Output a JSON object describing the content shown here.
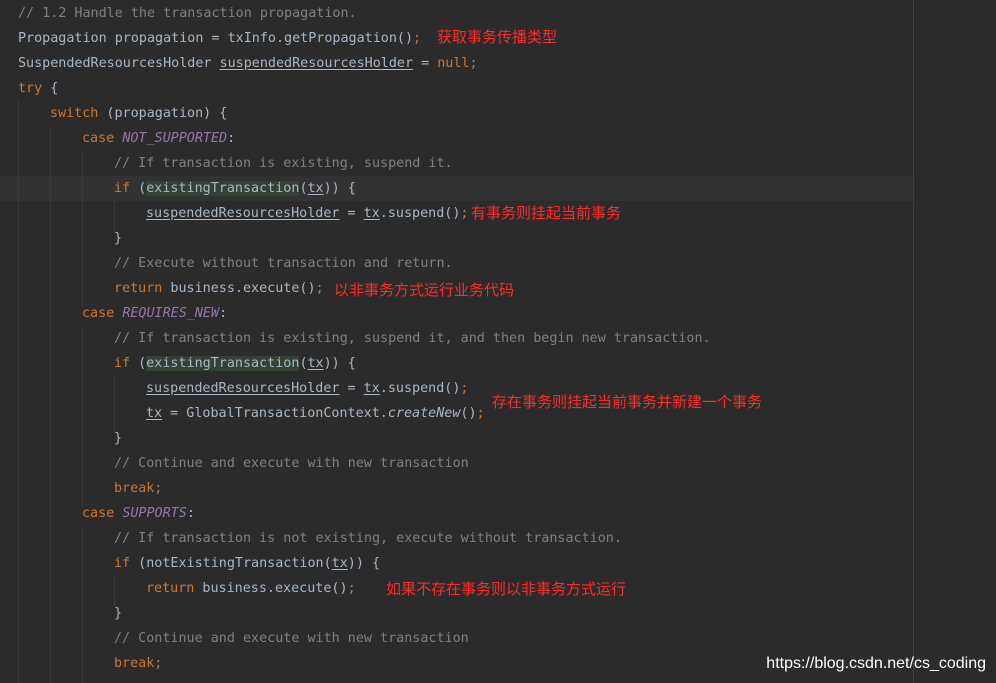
{
  "code": {
    "l1": {
      "comment": "// 1.2 Handle the transaction propagation."
    },
    "l2": {
      "t1": "Propagation propagation = txInfo.getPropagation()",
      "t2": ";"
    },
    "l3": {
      "t1": "SuspendedResourcesHolder ",
      "t2": "suspendedResourcesHolder",
      "t3": " = ",
      "t4": "null",
      "t5": ";"
    },
    "l4": {
      "kw": "try",
      "t1": " {"
    },
    "l5": {
      "kw": "switch",
      "t1": " (propagation) {"
    },
    "l6": {
      "kw": "case ",
      "const": "NOT_SUPPORTED",
      "t1": ":"
    },
    "l7": {
      "comment": "// If transaction is existing, suspend it."
    },
    "l8": {
      "kw": "if",
      "t1": " (",
      "hl": "existingTransaction",
      "t2": "(",
      "var": "tx",
      "t3": ")) {"
    },
    "l9": {
      "t1": "suspendedResourcesHolder",
      "t2": " = ",
      "var": "tx",
      "t3": ".suspend()",
      "t4": ";"
    },
    "l10": {
      "t1": "}"
    },
    "l11": {
      "comment": "// Execute without transaction and return."
    },
    "l12": {
      "kw": "return",
      "t1": " business.execute()",
      "t2": ";"
    },
    "l13": {
      "kw": "case ",
      "const": "REQUIRES_NEW",
      "t1": ":"
    },
    "l14": {
      "comment": "// If transaction is existing, suspend it, and then begin new transaction."
    },
    "l15": {
      "kw": "if",
      "t1": " (",
      "hl": "existingTransaction",
      "t2": "(",
      "var": "tx",
      "t3": ")) {"
    },
    "l16": {
      "t1": "suspendedResourcesHolder",
      "t2": " = ",
      "var": "tx",
      "t3": ".suspend()",
      "t4": ";"
    },
    "l17": {
      "var": "tx",
      "t1": " = GlobalTransactionContext.",
      "it": "createNew",
      "t2": "()",
      "t3": ";"
    },
    "l18": {
      "t1": "}"
    },
    "l19": {
      "comment": "// Continue and execute with new transaction"
    },
    "l20": {
      "kw": "break;"
    },
    "l21": {
      "kw": "case ",
      "const": "SUPPORTS",
      "t1": ":"
    },
    "l22": {
      "comment": "// If transaction is not existing, execute without transaction."
    },
    "l23": {
      "kw": "if",
      "t1": " (notExistingTransaction(",
      "var": "tx",
      "t2": ")) {"
    },
    "l24": {
      "kw": "return",
      "t1": " business.execute()",
      "t2": ";"
    },
    "l25": {
      "t1": "}"
    },
    "l26": {
      "comment": "// Continue and execute with new transaction"
    },
    "l27": {
      "kw": "break;"
    }
  },
  "annotations": {
    "a1": "获取事务传播类型",
    "a2": "有事务则挂起当前事务",
    "a3": "以非事务方式运行业务代码",
    "a4": "存在事务则挂起当前事务并新建一个事务",
    "a5": "如果不存在事务则以非事务方式运行"
  },
  "watermark": "https://blog.csdn.net/cs_coding",
  "colors": {
    "background": "#2b2b2b",
    "text": "#a9b7c6",
    "keyword": "#cc7832",
    "comment": "#808080",
    "constant": "#9876aa",
    "annotation": "#ff2b2b"
  }
}
